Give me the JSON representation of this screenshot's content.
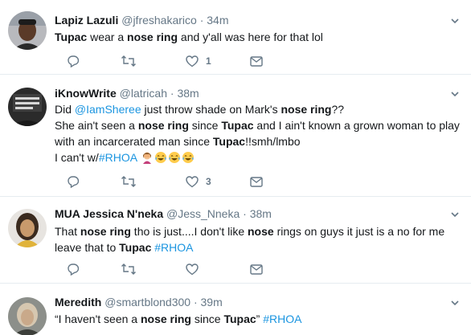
{
  "tweets": [
    {
      "name": "Lapiz Lazuli",
      "handle": "@jfreshakarico",
      "dot": "·",
      "time": "34m",
      "lines": [
        [
          {
            "t": "Tupac",
            "b": true
          },
          {
            "t": " wear a "
          },
          {
            "t": "nose ring",
            "b": true
          },
          {
            "t": " and y'all was here for that lol"
          }
        ]
      ],
      "reply_count": "",
      "retweet_count": "",
      "like_count": "1"
    },
    {
      "name": "iKnowWrite",
      "handle": "@latricah",
      "dot": "·",
      "time": "38m",
      "lines": [
        [
          {
            "t": "Did "
          },
          {
            "t": "@IamSheree",
            "l": true
          },
          {
            "t": " just throw shade on Mark's "
          },
          {
            "t": "nose ring",
            "b": true
          },
          {
            "t": "??"
          }
        ],
        [
          {
            "t": "She ain't seen a "
          },
          {
            "t": "nose ring",
            "b": true
          },
          {
            "t": " since "
          },
          {
            "t": "Tupac",
            "b": true
          },
          {
            "t": " and I ain't known a grown woman to play"
          }
        ],
        [
          {
            "t": "with an incarcerated man since "
          },
          {
            "t": "Tupac",
            "b": true
          },
          {
            "t": "!!smh/lmbo"
          }
        ],
        [
          {
            "t": "I can't w/"
          },
          {
            "t": "#RHOA",
            "l": true
          },
          {
            "t": " "
          }
        ]
      ],
      "emojis": [
        "woman-facepalming-emoji",
        "tears-of-joy-emoji",
        "tears-of-joy-emoji",
        "tears-of-joy-emoji"
      ],
      "reply_count": "",
      "retweet_count": "",
      "like_count": "3"
    },
    {
      "name": "MUA Jessica N'neka",
      "handle": "@Jess_Nneka",
      "dot": "·",
      "time": "38m",
      "lines": [
        [
          {
            "t": "That "
          },
          {
            "t": "nose ring",
            "b": true
          },
          {
            "t": " tho is just....I don't like "
          },
          {
            "t": "nose",
            "b": true
          },
          {
            "t": " rings on guys it just is a no for me"
          }
        ],
        [
          {
            "t": "leave that to "
          },
          {
            "t": "Tupac",
            "b": true
          },
          {
            "t": "  "
          },
          {
            "t": "#RHOA",
            "l": true
          }
        ]
      ],
      "reply_count": "",
      "retweet_count": "",
      "like_count": ""
    },
    {
      "name": "Meredith",
      "handle": "@smartblond300",
      "dot": "·",
      "time": "39m",
      "lines": [
        [
          {
            "t": "“I haven't seen a "
          },
          {
            "t": "nose ring",
            "b": true
          },
          {
            "t": " since "
          },
          {
            "t": "Tupac",
            "b": true
          },
          {
            "t": "” "
          },
          {
            "t": "#RHOA",
            "l": true
          }
        ]
      ]
    }
  ],
  "colors": {
    "text": "#14171a",
    "secondary": "#657786",
    "link": "#1b95e0",
    "divider": "#e6ecf0"
  },
  "icons": [
    "reply-icon",
    "retweet-icon",
    "like-icon",
    "direct-message-icon",
    "chevron-down-icon"
  ]
}
